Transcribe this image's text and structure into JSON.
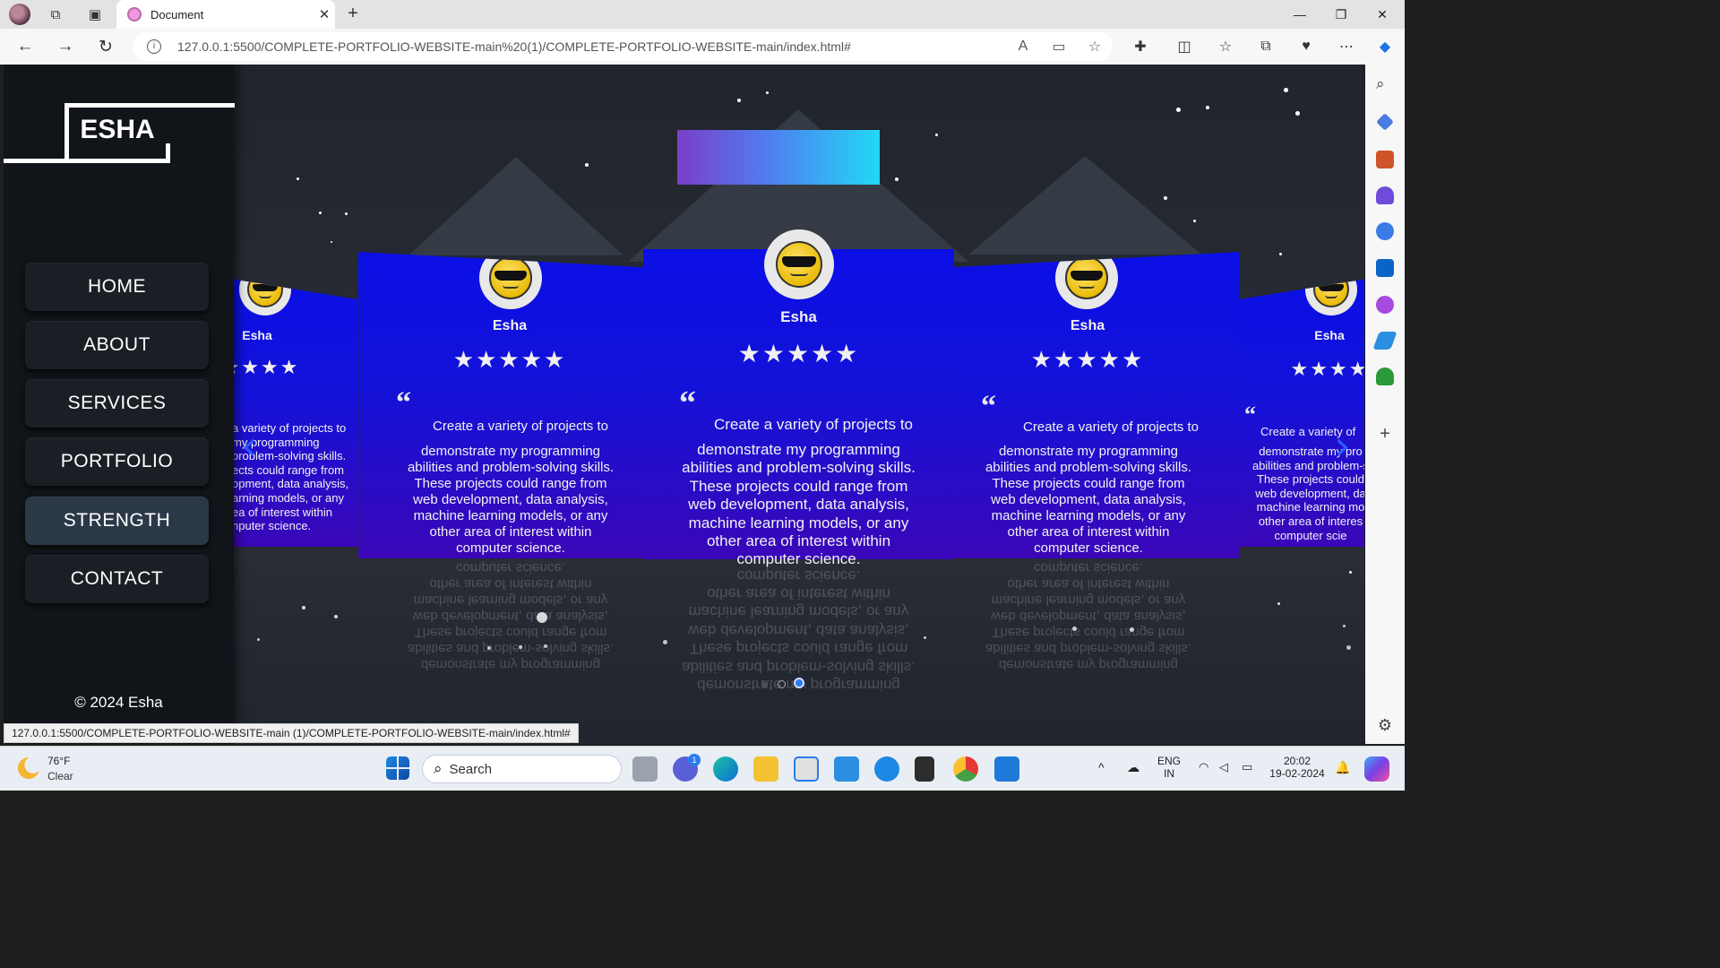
{
  "browser": {
    "tab_title": "Document",
    "url": "127.0.0.1:5500/COMPLETE-PORTFOLIO-WEBSITE-main%20(1)/COMPLETE-PORTFOLIO-WEBSITE-main/index.html#",
    "status_url": "127.0.0.1:5500/COMPLETE-PORTFOLIO-WEBSITE-main (1)/COMPLETE-PORTFOLIO-WEBSITE-main/index.html#"
  },
  "site": {
    "logo": "ESHA",
    "nav": [
      {
        "label": "HOME",
        "active": false
      },
      {
        "label": "ABOUT",
        "active": false
      },
      {
        "label": "SERVICES",
        "active": false
      },
      {
        "label": "PORTFOLIO",
        "active": false
      },
      {
        "label": "STRENGTH",
        "active": true
      },
      {
        "label": "CONTACT",
        "active": false
      }
    ],
    "footer": "© 2024 Esha"
  },
  "testimonials": {
    "cards": [
      {
        "name": "Esha",
        "stars": "★★★★",
        "text_lines": [
          "a variety of projects to",
          "my programming",
          "problem-solving skills.",
          "ects could range from",
          "opment, data analysis,",
          "arning models, or any",
          "ea of interest within",
          "nputer science."
        ]
      },
      {
        "name": "Esha",
        "stars": "★★★★★",
        "first_line": "Create a variety of projects to",
        "text_lines": [
          "demonstrate my programming",
          "abilities and problem-solving skills.",
          "These projects could range from",
          "web development, data analysis,",
          "machine learning models, or any",
          "other area of interest within",
          "computer science."
        ]
      },
      {
        "name": "Esha",
        "stars": "★★★★★",
        "first_line": "Create a variety of projects to",
        "text_lines": [
          "demonstrate my programming",
          "abilities and problem-solving skills.",
          "These projects could range from",
          "web development, data analysis,",
          "machine learning models, or any",
          "other area of interest within",
          "computer science."
        ]
      },
      {
        "name": "Esha",
        "stars": "★★★★★",
        "first_line": "Create a variety of projects to",
        "text_lines": [
          "demonstrate my programming",
          "abilities and problem-solving skills.",
          "These projects could range from",
          "web development, data analysis,",
          "machine learning models, or any",
          "other area of interest within",
          "computer science."
        ]
      },
      {
        "name": "Esha",
        "stars": "★★★★",
        "first_line": "Create a variety of",
        "text_lines": [
          "demonstrate my pro",
          "abilities and problem-s",
          "These projects could",
          "web development, da",
          "machine learning mo",
          "other area of interes",
          "computer scie"
        ]
      }
    ],
    "quote_mark": "“",
    "prev_arrow": "‹",
    "next_arrow": "›",
    "active_dot": 2,
    "dot_count": 3
  },
  "taskbar": {
    "temp": "76°F",
    "condition": "Clear",
    "search": "Search",
    "lang_top": "ENG",
    "lang_bottom": "IN",
    "time": "20:02",
    "date": "19-02-2024",
    "teams_badge": "1"
  },
  "colors": {
    "card_top": "#0b0fe6",
    "card_bottom": "#3a07b8",
    "heading_gradient_start": "#7a3fc8",
    "heading_gradient_end": "#22d8f5",
    "active_nav": "#2b3848"
  }
}
